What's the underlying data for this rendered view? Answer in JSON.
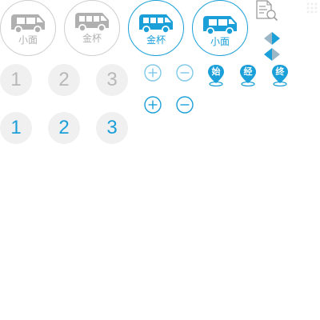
{
  "vehicle_buttons": [
    {
      "label": "小面",
      "state": "inactive"
    },
    {
      "label": "金杯",
      "state": "inactive"
    },
    {
      "label": "金杯",
      "state": "active"
    },
    {
      "label": "小面",
      "state": "active"
    }
  ],
  "number_buttons": {
    "inactive": [
      "1",
      "2",
      "3"
    ],
    "active": [
      "1",
      "2",
      "3"
    ]
  },
  "map_pins": [
    {
      "label": "始"
    },
    {
      "label": "经"
    },
    {
      "label": "终"
    }
  ],
  "icons": {
    "document_search": "document-search-icon",
    "zoom_in": "zoom-in-icon",
    "zoom_out": "zoom-out-icon",
    "diamond": "diamond-icon"
  },
  "colors": {
    "accent": "#1a9fd9",
    "inactive_gray": "#b0b0b0",
    "number_bg": "#f0f0f0"
  }
}
